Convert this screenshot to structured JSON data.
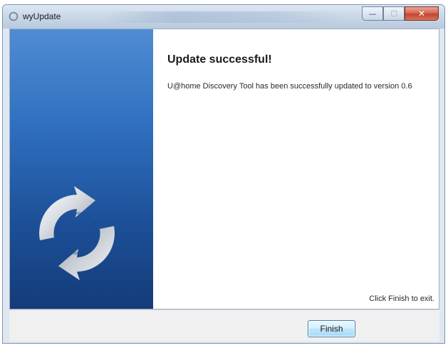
{
  "window": {
    "title": "wyUpdate",
    "caption_buttons": {
      "minimize_glyph": "—",
      "maximize_glyph": "☐",
      "close_glyph": "✕"
    }
  },
  "icons": {
    "app": "update-icon",
    "logo": "sync-arrows-icon"
  },
  "content": {
    "heading": "Update successful!",
    "message": "U@home Discovery Tool has been successfully updated to version 0.6",
    "exit_hint": "Click Finish to exit."
  },
  "footer": {
    "finish_label": "Finish"
  },
  "colors": {
    "side_panel_top": "#4f8cd3",
    "side_panel_bottom": "#143c78",
    "close_button": "#c2452e",
    "button_border": "#3c7fb1"
  }
}
